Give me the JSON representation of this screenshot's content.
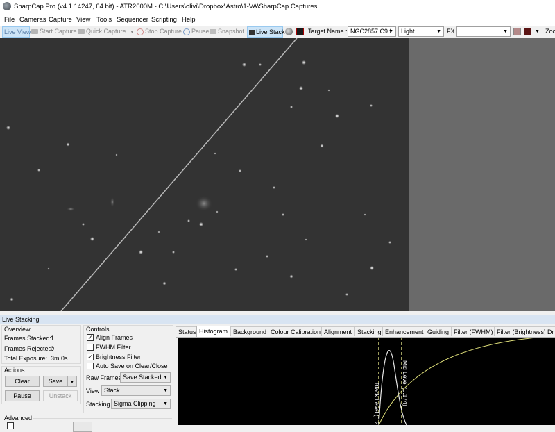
{
  "window": {
    "title": "SharpCap Pro (v4.1.14247, 64 bit) - ATR2600M - C:\\Users\\olivi\\Dropbox\\Astro\\1-VA\\SharpCap Captures"
  },
  "menu": [
    "File",
    "Cameras",
    "Capture",
    "View",
    "Tools",
    "Sequencer",
    "Scripting",
    "Help"
  ],
  "toolbar": {
    "live_view": "Live View",
    "start_capture": "Start Capture",
    "quick_capture": "Quick Capture",
    "stop_capture": "Stop Capture",
    "pause": "Pause",
    "snapshot": "Snapshot",
    "live_stack": "Live Stack",
    "target_name_label": "Target Name :",
    "target_name_value": "NGC2857 C9 f",
    "frame_type": "Light",
    "fx_label": "FX",
    "fx_value": "",
    "zoom_label": "Zoc"
  },
  "live_stacking": {
    "title": "Live Stacking",
    "overview": {
      "title": "Overview",
      "frames_stacked_label": "Frames Stacked:",
      "frames_stacked": "1",
      "frames_rejected_label": "Frames Rejected:",
      "frames_rejected": "0",
      "total_exposure_label": "Total Exposure:",
      "total_exposure": "3m 0s"
    },
    "actions": {
      "title": "Actions",
      "clear": "Clear",
      "save": "Save",
      "pause": "Pause",
      "unstack": "Unstack"
    },
    "advanced": {
      "title": "Advanced"
    },
    "controls": {
      "title": "Controls",
      "align_frames": "Align Frames",
      "fwhm_filter": "FWHM Filter",
      "brightness_filter": "Brightness Filter",
      "auto_save": "Auto Save on Clear/Close",
      "raw_frames_label": "Raw Frames",
      "raw_frames_value": "Save Stacked",
      "view_label": "View",
      "view_value": "Stack",
      "stacking_label": "Stacking",
      "stacking_value": "Sigma Clipping"
    },
    "tabs": [
      "Status",
      "Histogram",
      "Background",
      "Colour Calibration",
      "Alignment",
      "Stacking",
      "Enhancement",
      "Guiding",
      "Filter (FWHM)",
      "Filter (Brightness)",
      "Dr"
    ],
    "active_tab": "Histogram",
    "histogram": {
      "black_level_label": "Black Level (0.2",
      "mid_level_label": "Mid Level (0.174)"
    }
  }
}
